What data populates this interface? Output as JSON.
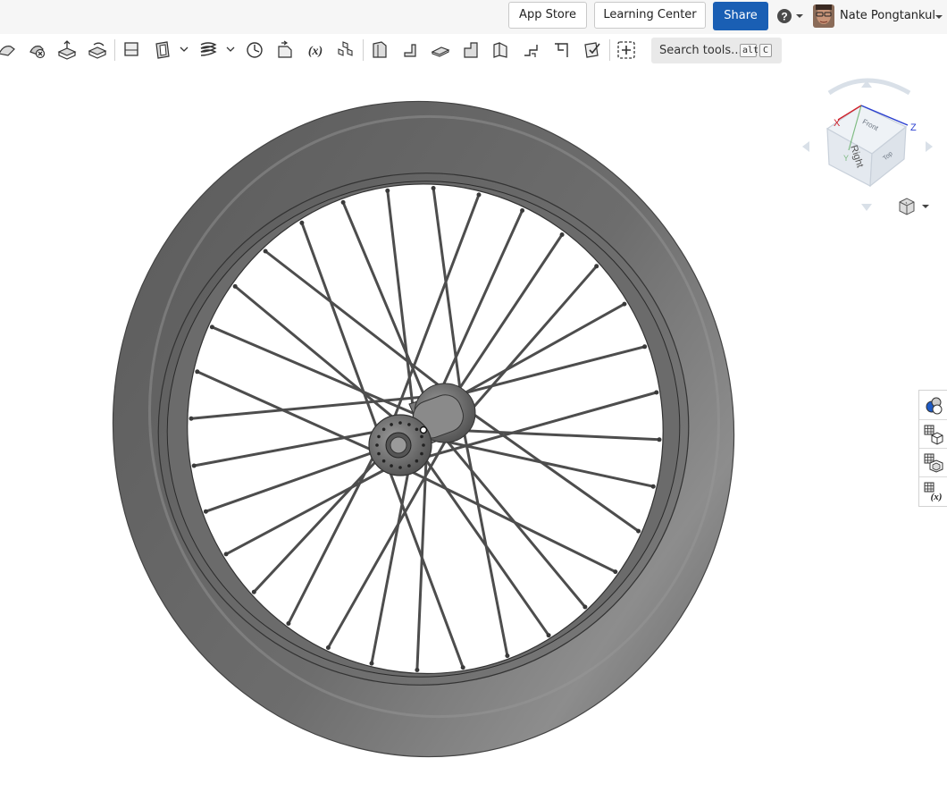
{
  "topbar": {
    "app_store": "App Store",
    "learning_center": "Learning Center",
    "share": "Share",
    "user_name": "Nate Pongtankul",
    "help_icon": "question-circle-icon",
    "share_color": "#1a5fb4"
  },
  "toolbar": {
    "tools": [
      "sweep-icon",
      "delete-part-icon",
      "extrude-icon",
      "revolve-icon",
      "plane-icon",
      "shell-icon",
      "helix-icon",
      "mate-connector-icon",
      "variable-icon",
      "pattern-icon",
      "sheet-metal-icon",
      "flange-icon",
      "tab-icon",
      "bend-icon",
      "form-icon",
      "hem-icon",
      "corner-icon",
      "finish-icon",
      "add-custom-feature-icon"
    ],
    "search": {
      "label": "Search tools...",
      "key1": "alt",
      "key2": "C"
    }
  },
  "viewcube": {
    "axis_x": "X",
    "axis_z": "Z",
    "axis_y": "Y",
    "face_front": "Front",
    "face_right": "Right",
    "face_top": "Top",
    "x_color": "#d0202a",
    "y_color": "#3a9a3a",
    "z_color": "#2a3fd0"
  },
  "viewport": {
    "model": "bicycle-wheel-model",
    "spoke_count": 32,
    "tire_color": "#6a6a6a"
  },
  "right_panel": {
    "items": [
      "appearance-icon",
      "parts-list-icon",
      "mate-icon",
      "variables-table-icon"
    ]
  }
}
